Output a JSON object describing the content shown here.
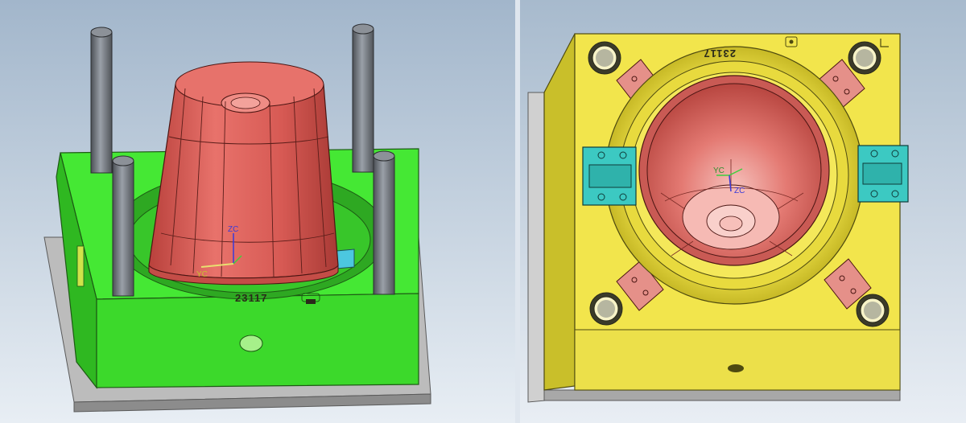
{
  "colors": {
    "viewport_top": "#9fb3c9",
    "viewport_bottom": "#e7edf3",
    "core_plate": "#3fe62e",
    "cavity_plate": "#f0e44a",
    "part": "#e0645e",
    "base_plate": "#b8b8b8",
    "guide_pin": "#6f737a",
    "slider": "#39c6c0",
    "pad": "#e38b86"
  },
  "left_view": {
    "part_number": "23117",
    "axis_labels": {
      "zc": "ZC",
      "yc": "YC"
    }
  },
  "right_view": {
    "part_number": "23117",
    "axis_labels": {
      "zc": "ZC",
      "yc": "YC"
    }
  }
}
